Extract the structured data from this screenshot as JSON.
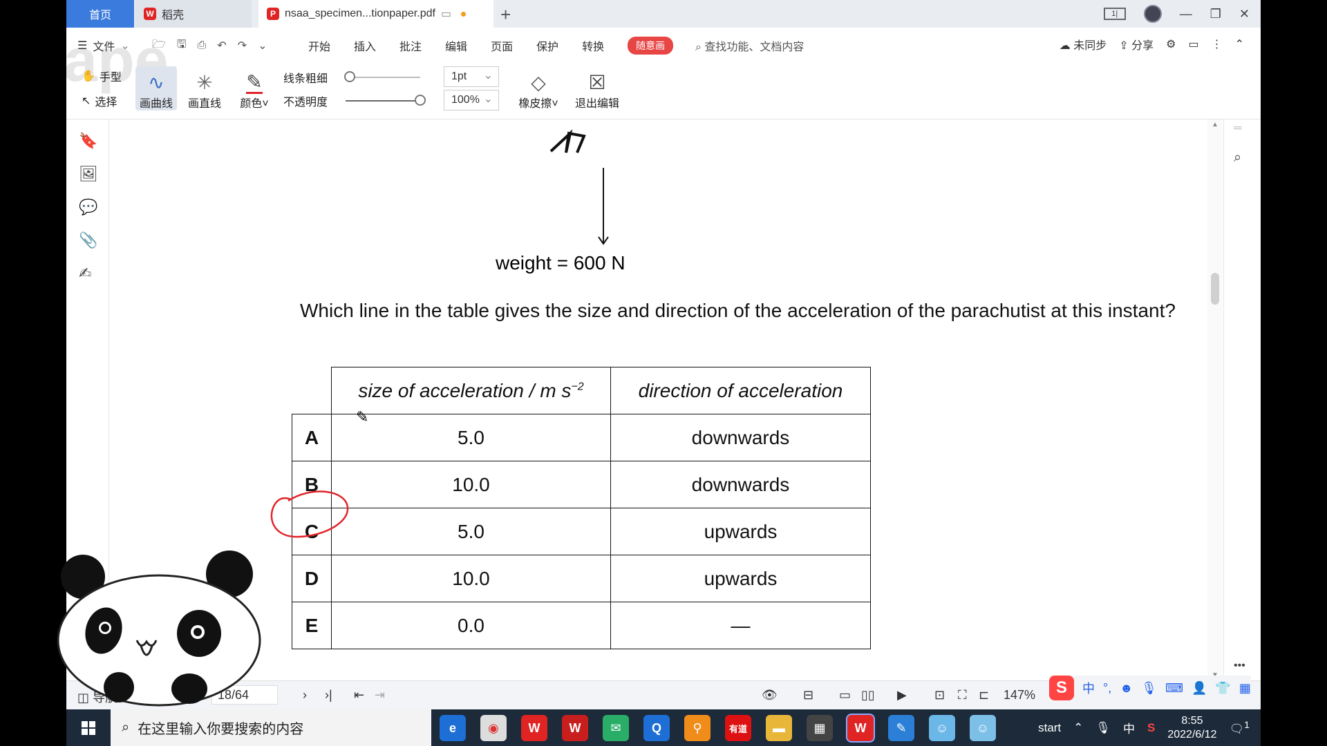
{
  "edge_text": "ape",
  "tabs": {
    "home": "首页",
    "tab1": "稻壳",
    "tab2": "nsaa_specimen...tionpaper.pdf",
    "add": "+"
  },
  "window": {
    "layout_icon": "1|"
  },
  "menu": {
    "file": "文件",
    "items": [
      "开始",
      "插入",
      "批注",
      "编辑",
      "页面",
      "保护",
      "转换"
    ],
    "pill": "随意画",
    "search_hint": "查找功能、文档内容",
    "unsynced": "未同步",
    "share": "分享"
  },
  "toolbar": {
    "hand": "手型",
    "select": "选择",
    "curve": "画曲线",
    "line": "画直线",
    "color": "颜色",
    "thickness": "线条粗细",
    "opacity": "不透明度",
    "thickness_value": "1pt",
    "opacity_value": "100%",
    "eraser": "橡皮擦",
    "exit": "退出编辑"
  },
  "page": {
    "weight": "weight = 600 N",
    "question": "Which line in the table gives the size and direction of the acceleration of the parachutist at this instant?",
    "table": {
      "h_size": "size of acceleration / m s",
      "h_size_sup": "−2",
      "h_dir": "direction of acceleration",
      "rows": [
        {
          "key": "A",
          "size": "5.0",
          "dir": "downwards"
        },
        {
          "key": "B",
          "size": "10.0",
          "dir": "downwards"
        },
        {
          "key": "C",
          "size": "5.0",
          "dir": "upwards"
        },
        {
          "key": "D",
          "size": "10.0",
          "dir": "upwards"
        },
        {
          "key": "E",
          "size": "0.0",
          "dir": "—"
        }
      ]
    }
  },
  "status": {
    "nav": "导航",
    "page": "18/64",
    "zoom": "147%"
  },
  "ime": {
    "logo": "S",
    "lang": "中"
  },
  "taskbar": {
    "search_placeholder": "在这里输入你要搜索的内容",
    "start_label": "start",
    "tray_lang": "中",
    "time": "8:55",
    "date": "2022/6/12",
    "notif_count": "1",
    "app_youdao": "有道"
  },
  "colors": {
    "accent": "#3b7bdd",
    "annotation": "#e0242a",
    "taskbar": "#1c2a3a"
  }
}
